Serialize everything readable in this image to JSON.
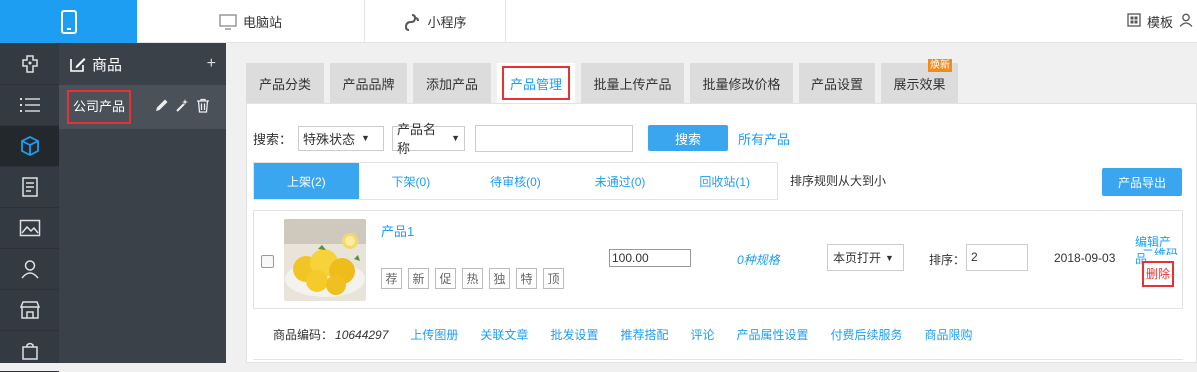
{
  "topbar": {
    "mobile_icon": "mobile-phone-icon",
    "pc_label": "电脑站",
    "mini_label": "小程序",
    "template_label": "模板",
    "user_label": "·"
  },
  "rail": {
    "icons": [
      "plugin-icon",
      "list-icon",
      "cube-icon",
      "document-icon",
      "image-icon",
      "user-icon",
      "store-icon",
      "bag-icon"
    ],
    "active_index": 2
  },
  "category_panel": {
    "title": "商品",
    "add_label": "+",
    "items": [
      {
        "label": "公司产品"
      }
    ]
  },
  "tabs": [
    {
      "label": "产品分类"
    },
    {
      "label": "产品品牌"
    },
    {
      "label": "添加产品"
    },
    {
      "label": "产品管理",
      "active": true
    },
    {
      "label": "批量上传产品"
    },
    {
      "label": "批量修改价格"
    },
    {
      "label": "产品设置"
    },
    {
      "label": "展示效果",
      "badge": "焕新"
    }
  ],
  "search": {
    "label": "搜索：",
    "status_select": "特殊状态",
    "field_select": "产品名称",
    "input_value": "",
    "button": "搜索",
    "all_link": "所有产品"
  },
  "status_tabs": [
    {
      "label": "上架(2)",
      "active": true
    },
    {
      "label": "下架(0)"
    },
    {
      "label": "待审核(0)"
    },
    {
      "label": "未通过(0)"
    },
    {
      "label": "回收站(1)"
    }
  ],
  "sort_rule": "排序规则从大到小",
  "export_button": "产品导出",
  "product": {
    "name": "产品1",
    "tags": [
      "荐",
      "新",
      "促",
      "热",
      "独",
      "特",
      "顶"
    ],
    "price": "100.00",
    "spec": "0种规格",
    "open_mode": "本页打开",
    "sort_label": "排序：",
    "sort_value": "2",
    "date": "2018-09-03",
    "edit_link": "编辑产品",
    "qr_link": "二维码",
    "delete_link": "删除",
    "code_label": "商品编码：",
    "code_value": "10644297",
    "links": [
      "上传图册",
      "关联文章",
      "批发设置",
      "推荐搭配",
      "评论",
      "产品属性设置",
      "付费后续服务",
      "商品限购"
    ]
  },
  "colors": {
    "accent": "#1e9ef2",
    "highlight": "#e53333",
    "rail_bg": "#333a41",
    "panel_bg": "#3b4148"
  }
}
